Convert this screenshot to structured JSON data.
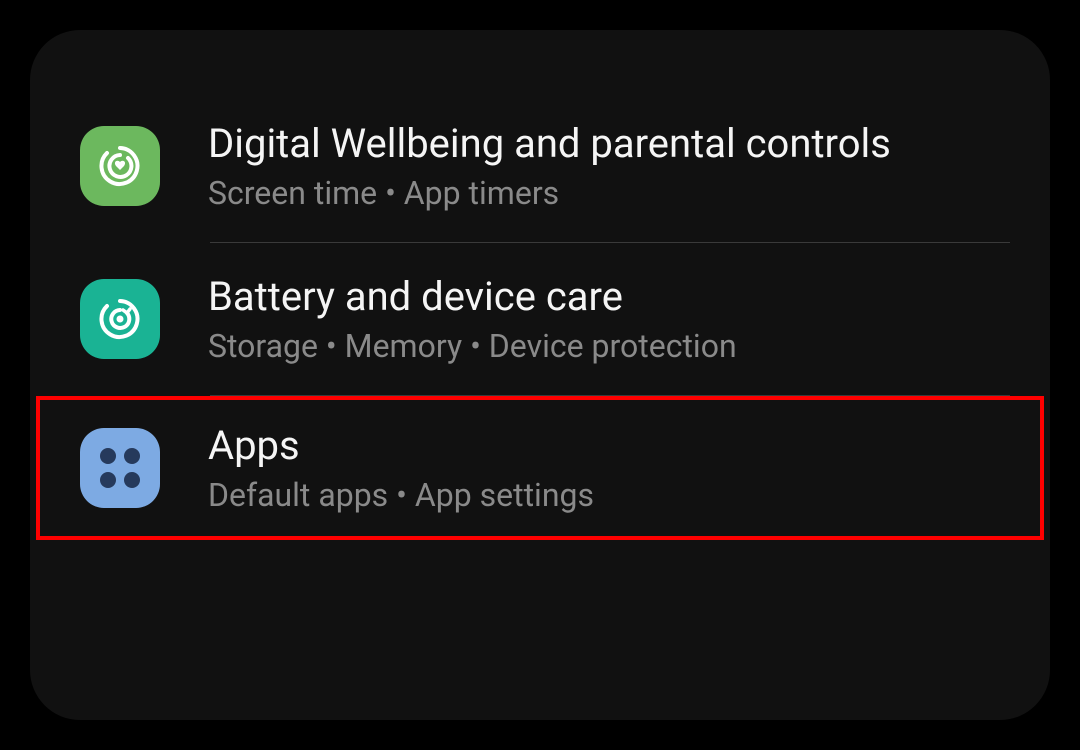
{
  "settings": {
    "items": [
      {
        "title": "Digital Wellbeing and parental controls",
        "subtitle": "Screen time  •  App timers",
        "icon": "wellbeing-icon",
        "iconColor": "#6cb85e"
      },
      {
        "title": "Battery and device care",
        "subtitle": "Storage  •  Memory  •  Device protection",
        "icon": "devicecare-icon",
        "iconColor": "#1ab394"
      },
      {
        "title": "Apps",
        "subtitle": "Default apps  •  App settings",
        "icon": "apps-icon",
        "iconColor": "#7daae3",
        "highlighted": true
      }
    ]
  }
}
